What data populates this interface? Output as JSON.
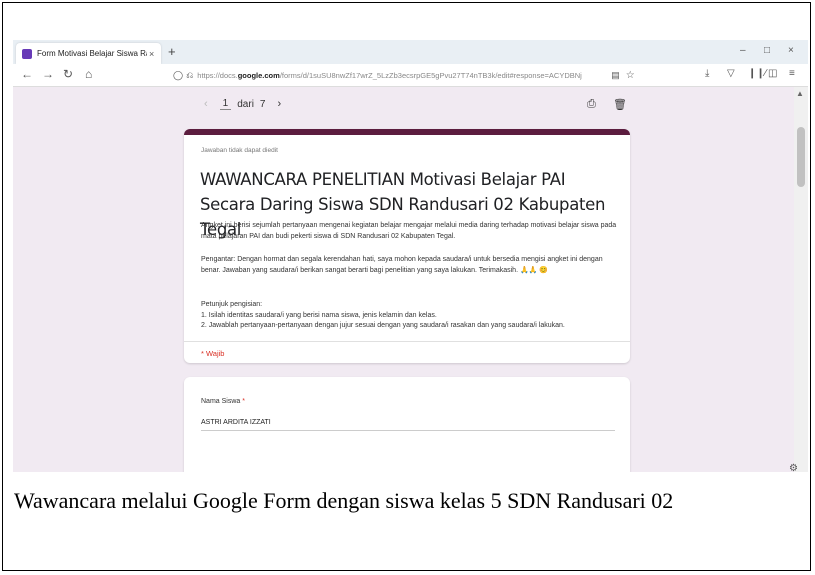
{
  "browser": {
    "tab_title": "Form Motivasi Belajar Siswa Ra…",
    "tab_close": "×",
    "new_tab": "+",
    "url_prefix": "https://docs.",
    "url_domain": "google.com",
    "url_suffix": "/forms/d/1suSU8nwZf17wrZ_5LzZb3ecsrpGE5gPvu27T74nTB3k/edit#response=ACYDBNj",
    "window_controls": [
      "–",
      "□",
      "×"
    ]
  },
  "form": {
    "pager": {
      "prev": "‹",
      "current": "1",
      "of": "dari",
      "total": "7",
      "next": "›"
    },
    "not_editable": "Jawaban tidak dapat diedit",
    "title": "WAWANCARA PENELITIAN Motivasi Belajar PAI Secara Daring Siswa SDN Randusari 02 Kabupaten Tegal",
    "desc1": "Angket ini berisi sejumlah pertanyaan mengenai kegiatan belajar mengajar melalui media daring terhadap motivasi belajar siswa pada mata pelajaran PAI dan budi pekerti  siswa di SDN Randusari 02 Kabupaten Tegal.",
    "desc2": "Pengantar:  Dengan hormat dan segala kerendahan hati, saya mohon kepada saudara/i untuk bersedia mengisi angket ini dengan benar. Jawaban yang saudara/i berikan sangat berarti bagi penelitian yang saya lakukan. Terimakasih. 🙏🙏 😊",
    "desc3": "Petunjuk pengisian:\n1.  Isilah identitas saudara/i yang berisi nama siswa, jenis kelamin dan kelas.\n2.  Jawablah pertanyaan-pertanyaan dengan jujur sesuai dengan yang saudara/i rasakan dan yang saudara/i lakukan.",
    "required_note": "* Wajib",
    "field_label": "Nama Siswa",
    "field_star": "*",
    "field_value": "ASTRI ARDITA IZZATI"
  },
  "caption": "Wawancara melalui Google Form dengan siswa kelas 5 SDN Randusari 02",
  "colors": {
    "header_accent": "#5c1d3f",
    "background": "#f1eaf2",
    "required": "#d93025",
    "favicon": "#673ab7"
  },
  "icons": [
    "form-favicon-icon",
    "back-icon",
    "forward-icon",
    "reload-icon",
    "home-icon",
    "shield-icon",
    "lock-icon",
    "reader-icon",
    "star-icon",
    "download-icon",
    "pocket-icon",
    "library-icon",
    "sidebar-icon",
    "menu-icon",
    "print-icon",
    "trash-icon",
    "help-icon"
  ]
}
